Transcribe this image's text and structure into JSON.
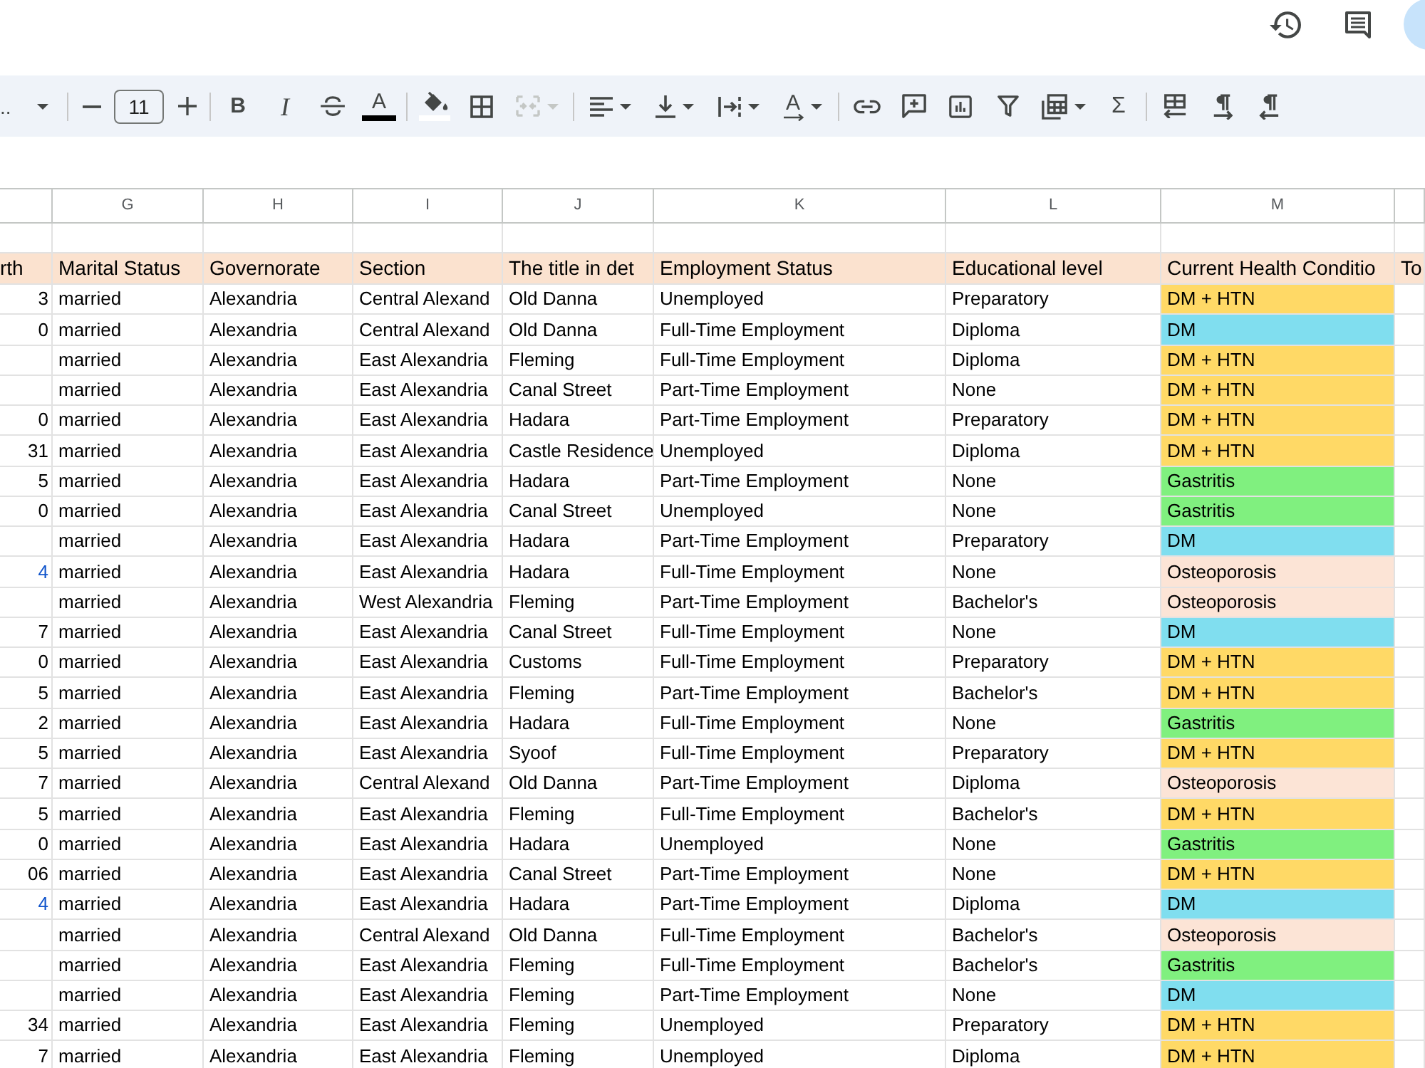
{
  "top_bar": {
    "actions": [
      {
        "kind": "history"
      },
      {
        "kind": "comments"
      },
      {
        "kind": "account"
      }
    ]
  },
  "toolbar": {
    "groups": [
      [
        {
          "kind": "font",
          "label": "..",
          "dropdown": true,
          "disabled": false
        }
      ],
      [
        {
          "kind": "decrease_size",
          "dropdown": false,
          "disabled": false
        },
        {
          "kind": "font_size",
          "value": "11",
          "dropdown": false,
          "disabled": false
        },
        {
          "kind": "increase_size",
          "dropdown": false,
          "disabled": false
        }
      ],
      [
        {
          "kind": "bold",
          "glyph": "B",
          "dropdown": false,
          "disabled": false
        },
        {
          "kind": "italic",
          "glyph": "I",
          "dropdown": false,
          "disabled": false
        },
        {
          "kind": "strikethrough",
          "dropdown": false,
          "disabled": false
        },
        {
          "kind": "text_color",
          "glyph": "A",
          "color": "#000000",
          "dropdown": false,
          "disabled": false
        }
      ],
      [
        {
          "kind": "fill_color",
          "color": "#ffffff",
          "dropdown": false,
          "disabled": false
        },
        {
          "kind": "borders",
          "dropdown": false,
          "disabled": false
        },
        {
          "kind": "merge",
          "dropdown": true,
          "disabled": true
        }
      ],
      [
        {
          "kind": "align",
          "dropdown": true,
          "disabled": false
        },
        {
          "kind": "valign",
          "dropdown": true,
          "disabled": false
        },
        {
          "kind": "wrap",
          "dropdown": true,
          "disabled": false
        },
        {
          "kind": "rotate",
          "glyph": "A",
          "dropdown": true,
          "disabled": false
        }
      ],
      [
        {
          "kind": "link",
          "dropdown": false,
          "disabled": false
        },
        {
          "kind": "comment",
          "dropdown": false,
          "disabled": false
        },
        {
          "kind": "chart",
          "dropdown": false,
          "disabled": false
        },
        {
          "kind": "filter",
          "dropdown": false,
          "disabled": false
        },
        {
          "kind": "table",
          "dropdown": true,
          "disabled": false
        },
        {
          "kind": "functions",
          "glyph": "Σ",
          "dropdown": false,
          "disabled": false
        }
      ],
      [
        {
          "kind": "sheet_direction",
          "dropdown": false,
          "disabled": false
        },
        {
          "kind": "ltr",
          "dropdown": false,
          "disabled": false
        },
        {
          "kind": "rtl",
          "dropdown": false,
          "disabled": false
        }
      ]
    ]
  },
  "sheet": {
    "column_letters": [
      "G",
      "H",
      "I",
      "J",
      "K",
      "L",
      "M"
    ],
    "header_row": [
      "rth",
      "Marital Status",
      "Governorate",
      "Section",
      "The title in det",
      "Employment Status",
      "Educational level",
      "Current Health Conditio",
      "To"
    ],
    "rows": [
      {
        "f": {
          "text": "3",
          "color": "#000000"
        },
        "cells": [
          "married",
          "Alexandria",
          "Central Alexand",
          "Old Danna",
          "Unemployed",
          "Preparatory"
        ],
        "condition": "DM + HTN",
        "color": "#ffd966"
      },
      {
        "f": {
          "text": "0",
          "color": "#000000"
        },
        "cells": [
          "married",
          "Alexandria",
          "Central Alexand",
          "Old Danna",
          "Full-Time Employment",
          "Diploma"
        ],
        "condition": "DM",
        "color": "#80deef"
      },
      {
        "cells": [
          "married",
          "Alexandria",
          "East Alexandria",
          "Fleming",
          "Full-Time Employment",
          "Diploma"
        ],
        "condition": "DM + HTN",
        "color": "#ffd966"
      },
      {
        "cells": [
          "married",
          "Alexandria",
          "East Alexandria",
          "Canal Street",
          "Part-Time Employment",
          "None"
        ],
        "condition": "DM + HTN",
        "color": "#ffd966"
      },
      {
        "f": {
          "text": "0",
          "color": "#000000"
        },
        "cells": [
          "married",
          "Alexandria",
          "East Alexandria",
          "Hadara",
          "Part-Time Employment",
          "Preparatory"
        ],
        "condition": "DM + HTN",
        "color": "#ffd966"
      },
      {
        "f": {
          "text": "31",
          "color": "#000000"
        },
        "cells": [
          "married",
          "Alexandria",
          "East Alexandria",
          "Castle Residence",
          "Unemployed",
          "Diploma"
        ],
        "condition": "DM + HTN",
        "color": "#ffd966"
      },
      {
        "f": {
          "text": "5",
          "color": "#000000"
        },
        "cells": [
          "married",
          "Alexandria",
          "East Alexandria",
          "Hadara",
          "Part-Time Employment",
          "None"
        ],
        "condition": "Gastritis",
        "color": "#80f07f"
      },
      {
        "f": {
          "text": "0",
          "color": "#000000"
        },
        "cells": [
          "married",
          "Alexandria",
          "East Alexandria",
          "Canal Street",
          "Unemployed",
          "None"
        ],
        "condition": "Gastritis",
        "color": "#80f07f"
      },
      {
        "cells": [
          "married",
          "Alexandria",
          "East Alexandria",
          "Hadara",
          "Part-Time Employment",
          "Preparatory"
        ],
        "condition": "DM",
        "color": "#80deef"
      },
      {
        "f": {
          "text": "4",
          "color": "#1155cc"
        },
        "cells": [
          "married",
          "Alexandria",
          "East Alexandria",
          "Hadara",
          "Full-Time Employment",
          "None"
        ],
        "condition": "Osteoporosis",
        "color": "#fce4d6"
      },
      {
        "cells": [
          "married",
          "Alexandria",
          "West Alexandria",
          "Fleming",
          "Part-Time Employment",
          "Bachelor's"
        ],
        "condition": "Osteoporosis",
        "color": "#fce4d6"
      },
      {
        "f": {
          "text": "7",
          "color": "#000000"
        },
        "cells": [
          "married",
          "Alexandria",
          "East Alexandria",
          "Canal Street",
          "Full-Time Employment",
          "None"
        ],
        "condition": "DM",
        "color": "#80deef"
      },
      {
        "f": {
          "text": "0",
          "color": "#000000"
        },
        "cells": [
          "married",
          "Alexandria",
          "East Alexandria",
          "Customs",
          "Full-Time Employment",
          "Preparatory"
        ],
        "condition": "DM + HTN",
        "color": "#ffd966"
      },
      {
        "f": {
          "text": "5",
          "color": "#000000"
        },
        "cells": [
          "married",
          "Alexandria",
          "East Alexandria",
          "Fleming",
          "Part-Time Employment",
          "Bachelor's"
        ],
        "condition": "DM + HTN",
        "color": "#ffd966"
      },
      {
        "f": {
          "text": "2",
          "color": "#000000"
        },
        "cells": [
          "married",
          "Alexandria",
          "East Alexandria",
          "Hadara",
          "Full-Time Employment",
          "None"
        ],
        "condition": "Gastritis",
        "color": "#80f07f"
      },
      {
        "f": {
          "text": "5",
          "color": "#000000"
        },
        "cells": [
          "married",
          "Alexandria",
          "East Alexandria",
          "Syoof",
          "Full-Time Employment",
          "Preparatory"
        ],
        "condition": "DM + HTN",
        "color": "#ffd966"
      },
      {
        "f": {
          "text": "7",
          "color": "#000000"
        },
        "cells": [
          "married",
          "Alexandria",
          "Central Alexand",
          "Old Danna",
          "Part-Time Employment",
          "Diploma"
        ],
        "condition": "Osteoporosis",
        "color": "#fce4d6"
      },
      {
        "f": {
          "text": "5",
          "color": "#000000"
        },
        "cells": [
          "married",
          "Alexandria",
          "East Alexandria",
          "Fleming",
          "Full-Time Employment",
          "Bachelor's"
        ],
        "condition": "DM + HTN",
        "color": "#ffd966"
      },
      {
        "f": {
          "text": "0",
          "color": "#000000"
        },
        "cells": [
          "married",
          "Alexandria",
          "East Alexandria",
          "Hadara",
          "Unemployed",
          "None"
        ],
        "condition": "Gastritis",
        "color": "#80f07f"
      },
      {
        "f": {
          "text": "06",
          "color": "#000000"
        },
        "cells": [
          "married",
          "Alexandria",
          "East Alexandria",
          "Canal Street",
          "Part-Time Employment",
          "None"
        ],
        "condition": "DM + HTN",
        "color": "#ffd966"
      },
      {
        "f": {
          "text": "4",
          "color": "#1155cc"
        },
        "cells": [
          "married",
          "Alexandria",
          "East Alexandria",
          "Hadara",
          "Part-Time Employment",
          "Diploma"
        ],
        "condition": "DM",
        "color": "#80deef"
      },
      {
        "cells": [
          "married",
          "Alexandria",
          "Central Alexand",
          "Old Danna",
          "Full-Time Employment",
          "Bachelor's"
        ],
        "condition": "Osteoporosis",
        "color": "#fce4d6"
      },
      {
        "cells": [
          "married",
          "Alexandria",
          "East Alexandria",
          "Fleming",
          "Full-Time Employment",
          "Bachelor's"
        ],
        "condition": "Gastritis",
        "color": "#80f07f"
      },
      {
        "cells": [
          "married",
          "Alexandria",
          "East Alexandria",
          "Fleming",
          "Part-Time Employment",
          "None"
        ],
        "condition": "DM",
        "color": "#80deef"
      },
      {
        "f": {
          "text": "34",
          "color": "#000000"
        },
        "cells": [
          "married",
          "Alexandria",
          "East Alexandria",
          "Fleming",
          "Unemployed",
          "Preparatory"
        ],
        "condition": "DM + HTN",
        "color": "#ffd966"
      },
      {
        "f": {
          "text": "7",
          "color": "#000000"
        },
        "cells": [
          "married",
          "Alexandria",
          "East Alexandria",
          "Fleming",
          "Unemployed",
          "Diploma"
        ],
        "condition": "DM + HTN",
        "color": "#ffd966"
      }
    ]
  }
}
